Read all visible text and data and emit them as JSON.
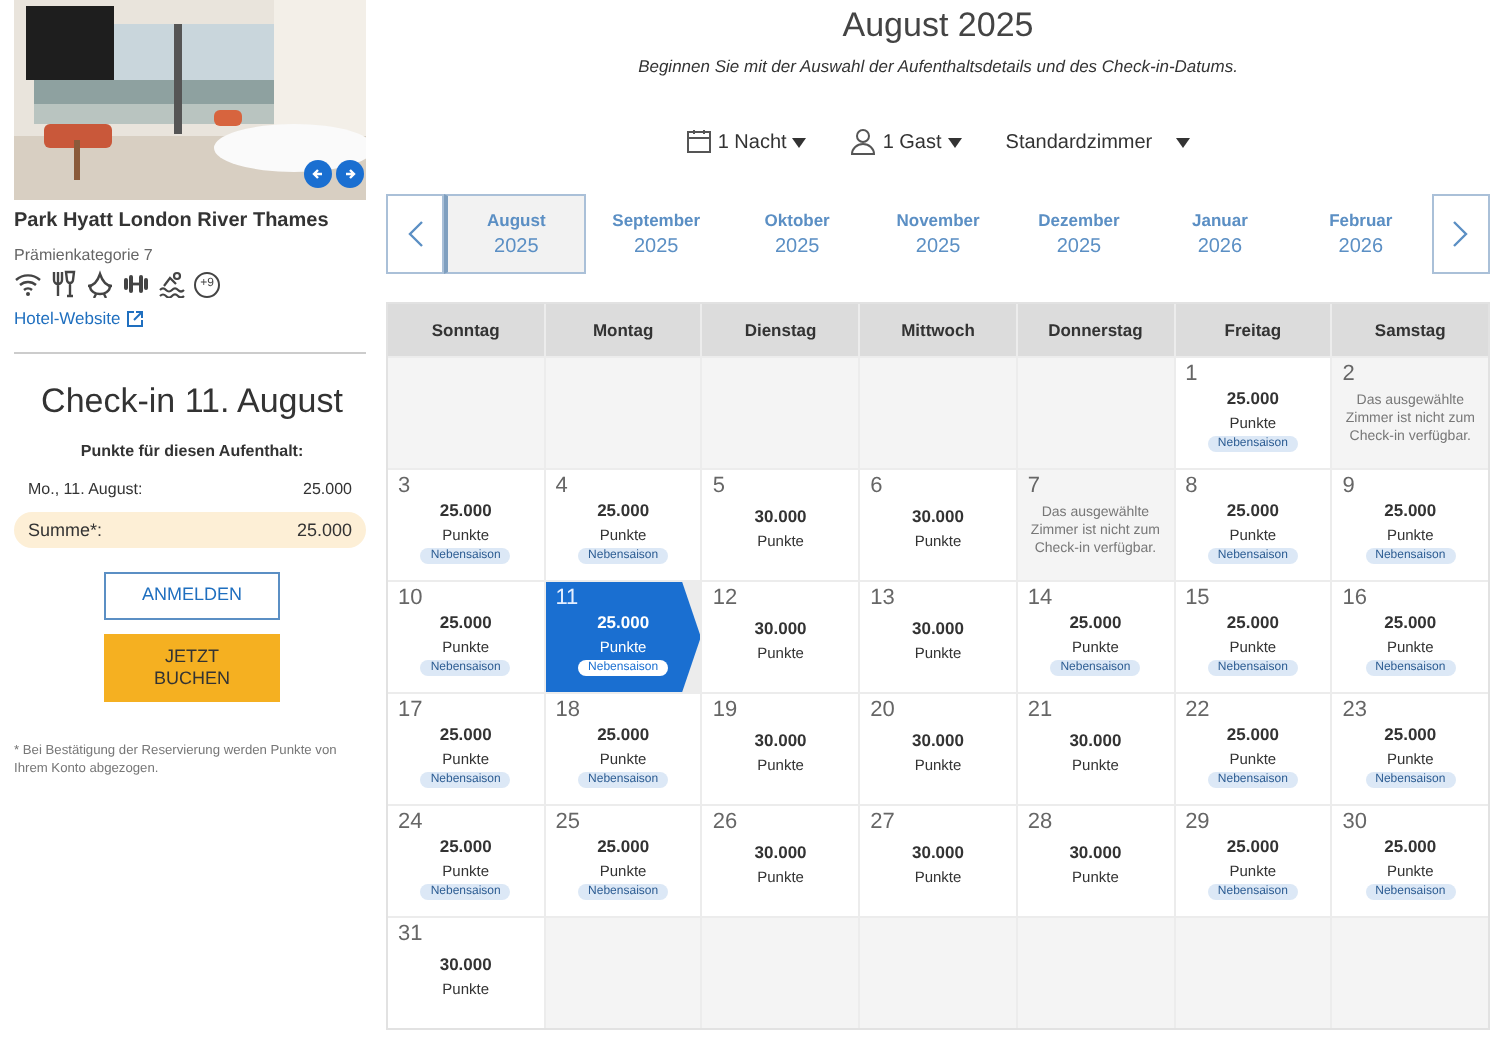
{
  "hotel": {
    "name": "Park Hyatt London River Thames",
    "category": "Prämienkategorie 7",
    "amenities": [
      {
        "kind": "wifi"
      },
      {
        "kind": "dining"
      },
      {
        "kind": "spa"
      },
      {
        "kind": "fitness"
      },
      {
        "kind": "pool"
      },
      {
        "kind": "more",
        "label": "+9"
      }
    ],
    "website_link": "Hotel-Website"
  },
  "summary": {
    "title": "Check-in 11. August",
    "subtitle": "Punkte für diesen Aufenthalt:",
    "lines": [
      {
        "kind": "night",
        "label": "Mo., 11. August:",
        "value": "25.000"
      },
      {
        "kind": "total",
        "label": "Summe*:",
        "value": "25.000"
      }
    ],
    "buttons": [
      {
        "kind": "outline",
        "label": "ANMELDEN"
      },
      {
        "kind": "primary",
        "label": "JETZT\nBUCHEN"
      }
    ],
    "footnote": "* Bei Bestätigung der Reservierung werden Punkte von Ihrem Konto abgezogen."
  },
  "calendar": {
    "title": "August 2025",
    "subtitle": "Beginnen Sie mit der Auswahl der Aufenthaltsdetails und des Check-in-Datums.",
    "filters": [
      {
        "kind": "nights",
        "label": "1 Nacht"
      },
      {
        "kind": "guests",
        "label": "1 Gast"
      },
      {
        "kind": "room",
        "label": "Standardzimmer"
      }
    ],
    "months": [
      {
        "month": "August",
        "year": "2025",
        "selected": true
      },
      {
        "month": "September",
        "year": "2025",
        "selected": false
      },
      {
        "month": "Oktober",
        "year": "2025",
        "selected": false
      },
      {
        "month": "November",
        "year": "2025",
        "selected": false
      },
      {
        "month": "Dezember",
        "year": "2025",
        "selected": false
      },
      {
        "month": "Januar",
        "year": "2026",
        "selected": false
      },
      {
        "month": "Februar",
        "year": "2026",
        "selected": false
      }
    ],
    "weekdays": [
      "Sonntag",
      "Montag",
      "Dienstag",
      "Mittwoch",
      "Donnerstag",
      "Freitag",
      "Samstag"
    ],
    "weeks": [
      [
        {
          "kind": "empty"
        },
        {
          "kind": "empty"
        },
        {
          "kind": "empty"
        },
        {
          "kind": "empty"
        },
        {
          "kind": "empty"
        },
        {
          "kind": "rate",
          "day": "1",
          "points": "25.000",
          "unit": "Punkte",
          "badge": "Nebensaison",
          "selected": false
        },
        {
          "kind": "unavailable",
          "day": "2",
          "note": "Das ausgewählte Zimmer ist nicht zum Check-in verfügbar."
        }
      ],
      [
        {
          "kind": "rate",
          "day": "3",
          "points": "25.000",
          "unit": "Punkte",
          "badge": "Nebensaison",
          "selected": false
        },
        {
          "kind": "rate",
          "day": "4",
          "points": "25.000",
          "unit": "Punkte",
          "badge": "Nebensaison",
          "selected": false
        },
        {
          "kind": "rate",
          "day": "5",
          "points": "30.000",
          "unit": "Punkte",
          "selected": false
        },
        {
          "kind": "rate",
          "day": "6",
          "points": "30.000",
          "unit": "Punkte",
          "selected": false
        },
        {
          "kind": "unavailable",
          "day": "7",
          "note": "Das ausgewählte Zimmer ist nicht zum Check-in verfügbar."
        },
        {
          "kind": "rate",
          "day": "8",
          "points": "25.000",
          "unit": "Punkte",
          "badge": "Nebensaison",
          "selected": false
        },
        {
          "kind": "rate",
          "day": "9",
          "points": "25.000",
          "unit": "Punkte",
          "badge": "Nebensaison",
          "selected": false
        }
      ],
      [
        {
          "kind": "rate",
          "day": "10",
          "points": "25.000",
          "unit": "Punkte",
          "badge": "Nebensaison",
          "selected": false
        },
        {
          "kind": "rate",
          "day": "11",
          "points": "25.000",
          "unit": "Punkte",
          "badge": "Nebensaison",
          "selected": true
        },
        {
          "kind": "rate",
          "day": "12",
          "points": "30.000",
          "unit": "Punkte",
          "selected": false
        },
        {
          "kind": "rate",
          "day": "13",
          "points": "30.000",
          "unit": "Punkte",
          "selected": false
        },
        {
          "kind": "rate",
          "day": "14",
          "points": "25.000",
          "unit": "Punkte",
          "badge": "Nebensaison",
          "selected": false
        },
        {
          "kind": "rate",
          "day": "15",
          "points": "25.000",
          "unit": "Punkte",
          "badge": "Nebensaison",
          "selected": false
        },
        {
          "kind": "rate",
          "day": "16",
          "points": "25.000",
          "unit": "Punkte",
          "badge": "Nebensaison",
          "selected": false
        }
      ],
      [
        {
          "kind": "rate",
          "day": "17",
          "points": "25.000",
          "unit": "Punkte",
          "badge": "Nebensaison",
          "selected": false
        },
        {
          "kind": "rate",
          "day": "18",
          "points": "25.000",
          "unit": "Punkte",
          "badge": "Nebensaison",
          "selected": false
        },
        {
          "kind": "rate",
          "day": "19",
          "points": "30.000",
          "unit": "Punkte",
          "selected": false
        },
        {
          "kind": "rate",
          "day": "20",
          "points": "30.000",
          "unit": "Punkte",
          "selected": false
        },
        {
          "kind": "rate",
          "day": "21",
          "points": "30.000",
          "unit": "Punkte",
          "selected": false
        },
        {
          "kind": "rate",
          "day": "22",
          "points": "25.000",
          "unit": "Punkte",
          "badge": "Nebensaison",
          "selected": false
        },
        {
          "kind": "rate",
          "day": "23",
          "points": "25.000",
          "unit": "Punkte",
          "badge": "Nebensaison",
          "selected": false
        }
      ],
      [
        {
          "kind": "rate",
          "day": "24",
          "points": "25.000",
          "unit": "Punkte",
          "badge": "Nebensaison",
          "selected": false
        },
        {
          "kind": "rate",
          "day": "25",
          "points": "25.000",
          "unit": "Punkte",
          "badge": "Nebensaison",
          "selected": false
        },
        {
          "kind": "rate",
          "day": "26",
          "points": "30.000",
          "unit": "Punkte",
          "selected": false
        },
        {
          "kind": "rate",
          "day": "27",
          "points": "30.000",
          "unit": "Punkte",
          "selected": false
        },
        {
          "kind": "rate",
          "day": "28",
          "points": "30.000",
          "unit": "Punkte",
          "selected": false
        },
        {
          "kind": "rate",
          "day": "29",
          "points": "25.000",
          "unit": "Punkte",
          "badge": "Nebensaison",
          "selected": false
        },
        {
          "kind": "rate",
          "day": "30",
          "points": "25.000",
          "unit": "Punkte",
          "badge": "Nebensaison",
          "selected": false
        }
      ],
      [
        {
          "kind": "rate",
          "day": "31",
          "points": "30.000",
          "unit": "Punkte",
          "selected": false
        },
        {
          "kind": "empty"
        },
        {
          "kind": "empty"
        },
        {
          "kind": "empty"
        },
        {
          "kind": "empty"
        },
        {
          "kind": "empty"
        },
        {
          "kind": "empty"
        }
      ]
    ]
  }
}
